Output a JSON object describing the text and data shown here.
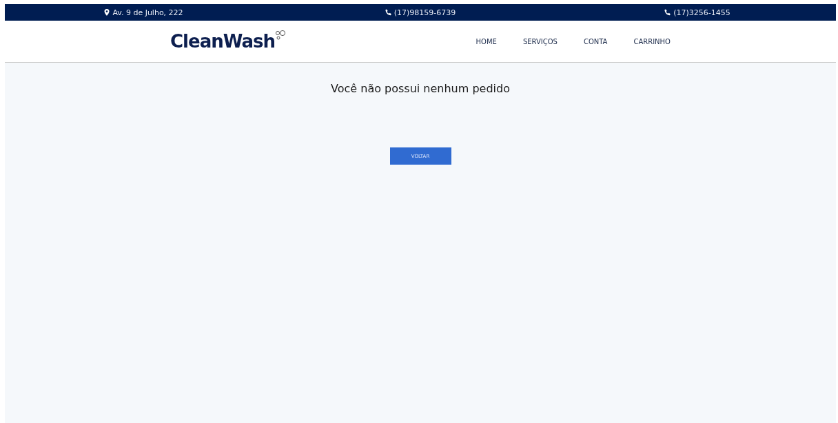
{
  "top_bar": [
    {
      "kind": "address",
      "text": "Av. 9 de Julho, 222"
    },
    {
      "kind": "phone",
      "text": "(17)98159-6739"
    },
    {
      "kind": "phone",
      "text": "(17)3256-1455"
    }
  ],
  "logo": "CleanWash",
  "nav": [
    "HOME",
    "SERVIÇOS",
    "CONTA",
    "CARRINHO"
  ],
  "message": "Você não possui nenhum pedido",
  "button": "VOLTAR"
}
